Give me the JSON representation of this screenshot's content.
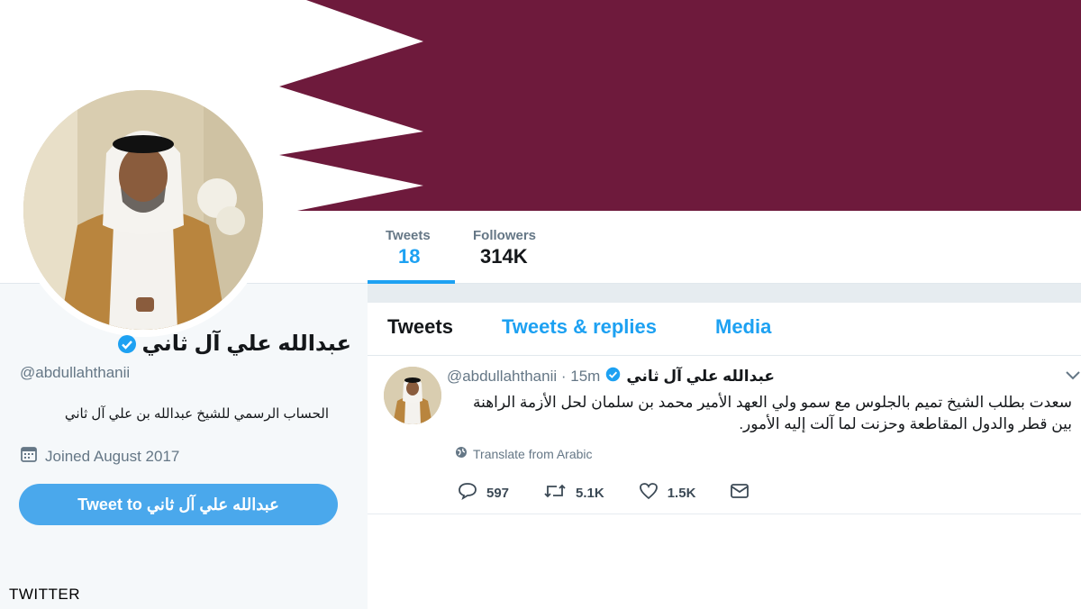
{
  "profile": {
    "name": "عبدالله علي آل ثاني",
    "handle": "@abdullahthanii",
    "bio": "الحساب الرسمي للشيخ عبدالله بن علي آل ثاني",
    "joined": "Joined August 2017",
    "tweet_to_button": "Tweet to عبدالله علي آل ثاني"
  },
  "stats": [
    {
      "label": "Tweets",
      "value": "18"
    },
    {
      "label": "Followers",
      "value": "314K"
    }
  ],
  "tabs": [
    "Tweets",
    "Tweets & replies",
    "Media"
  ],
  "tweet": {
    "name": "عبدالله علي آل ثاني",
    "handle": "@abdullahthanii",
    "time": "15m",
    "text": "سعدت بطلب الشيخ تميم بالجلوس مع سمو ولي العهد الأمير محمد بن سلمان لحل الأزمة الراهنة بين قطر والدول المقاطعة وحزنت لما آلت إليه الأمور.",
    "translate": "Translate from Arabic",
    "replies": "597",
    "retweets": "5.1K",
    "likes": "1.5K"
  },
  "watermark": "TWITTER",
  "colors": {
    "accent": "#1da1f2",
    "banner_maroon": "#6e1a3c",
    "button": "#4aa8ec"
  },
  "icons": [
    "verified-icon",
    "calendar-icon",
    "globe-icon",
    "reply-icon",
    "retweet-icon",
    "like-icon",
    "message-icon",
    "chevron-down-icon"
  ]
}
